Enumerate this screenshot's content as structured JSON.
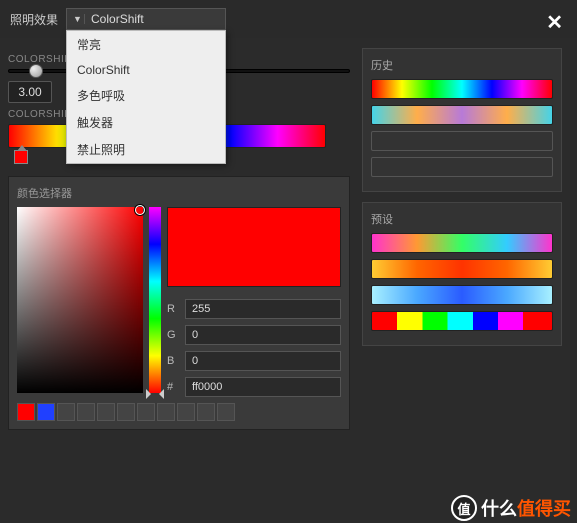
{
  "topbar": {
    "label": "照明效果",
    "selected": "ColorShift"
  },
  "dropdown": {
    "items": [
      "常亮",
      "ColorShift",
      "多色呼吸",
      "触发器",
      "禁止照明"
    ]
  },
  "left": {
    "section1_label": "COLORSHIFT",
    "speed_value": "3.00",
    "section2_label": "COLORSHIFT",
    "stops": [
      {
        "pos": 2,
        "color": "#ff0000"
      },
      {
        "pos": 34,
        "color": "#00ff00"
      },
      {
        "pos": 65,
        "color": "#0000ff"
      }
    ],
    "picker": {
      "title": "颜色选择器",
      "r_label": "R",
      "r_value": "255",
      "g_label": "G",
      "g_value": "0",
      "b_label": "B",
      "b_value": "0",
      "hex_label": "#",
      "hex_value": "ff0000",
      "preview_color": "#ff0000",
      "swatches": [
        "#ff0000",
        "#2040ff",
        "#444",
        "#444",
        "#444",
        "#444",
        "#444",
        "#444",
        "#444",
        "#444",
        "#444"
      ]
    }
  },
  "right": {
    "history_title": "历史",
    "history": [
      "linear-gradient(to right,#ff0000,#ffff00,#00ff00,#00ffff,#0000ff,#ff00ff,#ff0000)",
      "linear-gradient(to right,#45d3e8,#ffae4a,#b77ad8,#ffae4a,#45d3e8)"
    ],
    "presets_title": "预设",
    "presets": [
      "linear-gradient(to right,#ff33cc,#ff9933,#33ff66,#33ccff,#ff33cc)",
      "linear-gradient(to right,#ffcc33,#ff6600,#ff3300,#ff6600,#ffcc33)",
      "linear-gradient(to right,#a8f0ff,#4aa8ff,#2a5bff,#4aa8ff,#a8f0ff)",
      "linear-gradient(to right,#ff0000 0%,#ff0000 14%,#ffff00 14%,#ffff00 28%,#00ff00 28%,#00ff00 42%,#00ffff 42%,#00ffff 56%,#0000ff 56%,#0000ff 70%,#ff00ff 70%,#ff00ff 84%,#ff0000 84%)"
    ]
  },
  "watermark": {
    "icon": "值",
    "text_a": "什么",
    "text_b": "值得买"
  }
}
